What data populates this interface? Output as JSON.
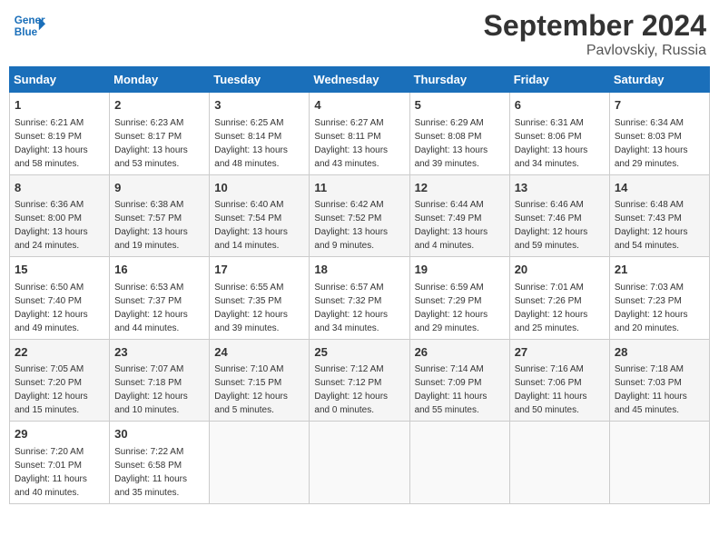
{
  "header": {
    "logo_text_general": "General",
    "logo_text_blue": "Blue",
    "title": "September 2024",
    "subtitle": "Pavlovskiy, Russia"
  },
  "weekdays": [
    "Sunday",
    "Monday",
    "Tuesday",
    "Wednesday",
    "Thursday",
    "Friday",
    "Saturday"
  ],
  "weeks": [
    [
      {
        "day": 1,
        "rise": "6:21 AM",
        "set": "8:19 PM",
        "hours": "13 hours",
        "mins": "58 minutes"
      },
      {
        "day": 2,
        "rise": "6:23 AM",
        "set": "8:17 PM",
        "hours": "13 hours",
        "mins": "53 minutes"
      },
      {
        "day": 3,
        "rise": "6:25 AM",
        "set": "8:14 PM",
        "hours": "13 hours",
        "mins": "48 minutes"
      },
      {
        "day": 4,
        "rise": "6:27 AM",
        "set": "8:11 PM",
        "hours": "13 hours",
        "mins": "43 minutes"
      },
      {
        "day": 5,
        "rise": "6:29 AM",
        "set": "8:08 PM",
        "hours": "13 hours",
        "mins": "39 minutes"
      },
      {
        "day": 6,
        "rise": "6:31 AM",
        "set": "8:06 PM",
        "hours": "13 hours",
        "mins": "34 minutes"
      },
      {
        "day": 7,
        "rise": "6:34 AM",
        "set": "8:03 PM",
        "hours": "13 hours",
        "mins": "29 minutes"
      }
    ],
    [
      {
        "day": 8,
        "rise": "6:36 AM",
        "set": "8:00 PM",
        "hours": "13 hours",
        "mins": "24 minutes"
      },
      {
        "day": 9,
        "rise": "6:38 AM",
        "set": "7:57 PM",
        "hours": "13 hours",
        "mins": "19 minutes"
      },
      {
        "day": 10,
        "rise": "6:40 AM",
        "set": "7:54 PM",
        "hours": "13 hours",
        "mins": "14 minutes"
      },
      {
        "day": 11,
        "rise": "6:42 AM",
        "set": "7:52 PM",
        "hours": "13 hours",
        "mins": "9 minutes"
      },
      {
        "day": 12,
        "rise": "6:44 AM",
        "set": "7:49 PM",
        "hours": "13 hours",
        "mins": "4 minutes"
      },
      {
        "day": 13,
        "rise": "6:46 AM",
        "set": "7:46 PM",
        "hours": "12 hours",
        "mins": "59 minutes"
      },
      {
        "day": 14,
        "rise": "6:48 AM",
        "set": "7:43 PM",
        "hours": "12 hours",
        "mins": "54 minutes"
      }
    ],
    [
      {
        "day": 15,
        "rise": "6:50 AM",
        "set": "7:40 PM",
        "hours": "12 hours",
        "mins": "49 minutes"
      },
      {
        "day": 16,
        "rise": "6:53 AM",
        "set": "7:37 PM",
        "hours": "12 hours",
        "mins": "44 minutes"
      },
      {
        "day": 17,
        "rise": "6:55 AM",
        "set": "7:35 PM",
        "hours": "12 hours",
        "mins": "39 minutes"
      },
      {
        "day": 18,
        "rise": "6:57 AM",
        "set": "7:32 PM",
        "hours": "12 hours",
        "mins": "34 minutes"
      },
      {
        "day": 19,
        "rise": "6:59 AM",
        "set": "7:29 PM",
        "hours": "12 hours",
        "mins": "29 minutes"
      },
      {
        "day": 20,
        "rise": "7:01 AM",
        "set": "7:26 PM",
        "hours": "12 hours",
        "mins": "25 minutes"
      },
      {
        "day": 21,
        "rise": "7:03 AM",
        "set": "7:23 PM",
        "hours": "12 hours",
        "mins": "20 minutes"
      }
    ],
    [
      {
        "day": 22,
        "rise": "7:05 AM",
        "set": "7:20 PM",
        "hours": "12 hours",
        "mins": "15 minutes"
      },
      {
        "day": 23,
        "rise": "7:07 AM",
        "set": "7:18 PM",
        "hours": "12 hours",
        "mins": "10 minutes"
      },
      {
        "day": 24,
        "rise": "7:10 AM",
        "set": "7:15 PM",
        "hours": "12 hours",
        "mins": "5 minutes"
      },
      {
        "day": 25,
        "rise": "7:12 AM",
        "set": "7:12 PM",
        "hours": "12 hours",
        "mins": "0 minutes"
      },
      {
        "day": 26,
        "rise": "7:14 AM",
        "set": "7:09 PM",
        "hours": "11 hours",
        "mins": "55 minutes"
      },
      {
        "day": 27,
        "rise": "7:16 AM",
        "set": "7:06 PM",
        "hours": "11 hours",
        "mins": "50 minutes"
      },
      {
        "day": 28,
        "rise": "7:18 AM",
        "set": "7:03 PM",
        "hours": "11 hours",
        "mins": "45 minutes"
      }
    ],
    [
      {
        "day": 29,
        "rise": "7:20 AM",
        "set": "7:01 PM",
        "hours": "11 hours",
        "mins": "40 minutes"
      },
      {
        "day": 30,
        "rise": "7:22 AM",
        "set": "6:58 PM",
        "hours": "11 hours",
        "mins": "35 minutes"
      },
      null,
      null,
      null,
      null,
      null
    ]
  ]
}
